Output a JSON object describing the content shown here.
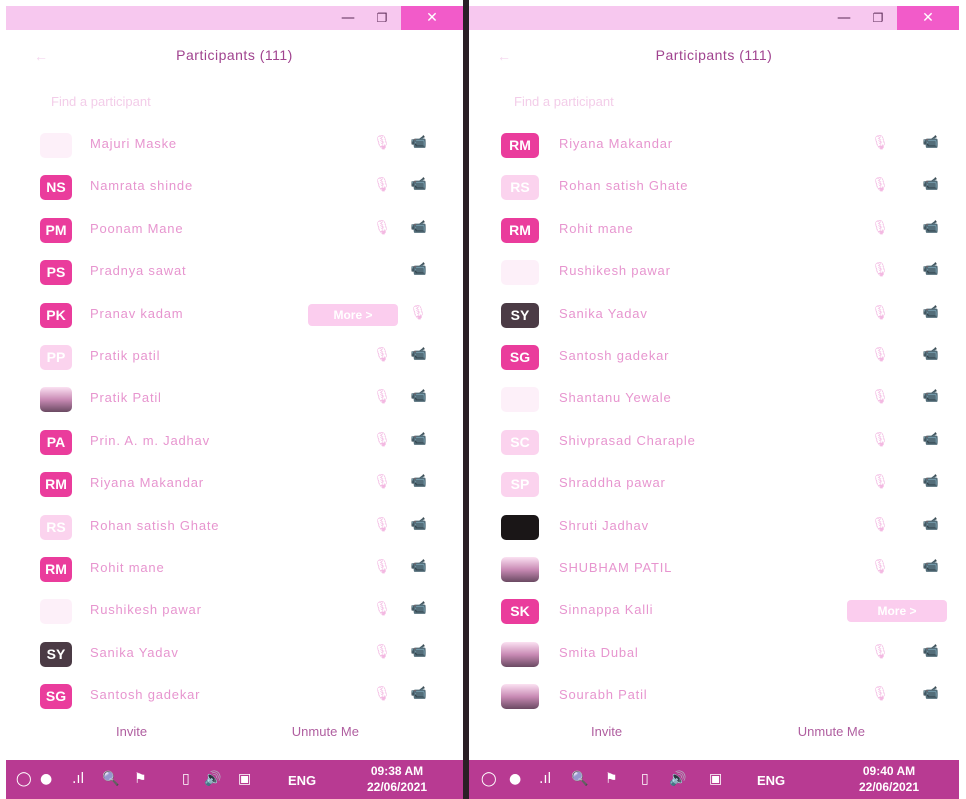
{
  "left": {
    "window": {
      "minimize": "—",
      "maximize": "❐",
      "close": "✕"
    },
    "header": {
      "back_icon": "←",
      "title": "Participants (111)"
    },
    "search": {
      "placeholder": "Find a participant"
    },
    "participants": [
      {
        "initials": "",
        "name": "Majuri Maske",
        "avatar": "blank",
        "icons": "mic-cam"
      },
      {
        "initials": "NS",
        "name": "Namrata shinde",
        "avatar": "solid",
        "icons": "mic-cam"
      },
      {
        "initials": "PM",
        "name": "Poonam Mane",
        "avatar": "solid",
        "icons": "mic-cam"
      },
      {
        "initials": "PS",
        "name": "Pradnya sawat",
        "avatar": "solid",
        "icons": "cam"
      },
      {
        "initials": "PK",
        "name": "Pranav kadam",
        "avatar": "solid",
        "icons": "more-mic",
        "more": "More >"
      },
      {
        "initials": "PP",
        "name": "Pratik patil",
        "avatar": "faded",
        "icons": "mic-cam"
      },
      {
        "initials": "",
        "name": "Pratik Patil",
        "avatar": "photo",
        "icons": "mic-cam"
      },
      {
        "initials": "PA",
        "name": "Prin. A. m. Jadhav",
        "avatar": "solid",
        "icons": "mic-cam"
      },
      {
        "initials": "RM",
        "name": "Riyana Makandar",
        "avatar": "solid",
        "icons": "mic-cam"
      },
      {
        "initials": "RS",
        "name": "Rohan satish Ghate",
        "avatar": "faded",
        "icons": "mic-cam"
      },
      {
        "initials": "RM",
        "name": "Rohit mane",
        "avatar": "solid",
        "icons": "mic-cam"
      },
      {
        "initials": "",
        "name": "Rushikesh pawar",
        "avatar": "blank",
        "icons": "mic-cam"
      },
      {
        "initials": "SY",
        "name": "Sanika Yadav",
        "avatar": "dark",
        "icons": "mic-cam"
      },
      {
        "initials": "SG",
        "name": "Santosh gadekar",
        "avatar": "solid",
        "icons": "mic-cam"
      }
    ],
    "footer": {
      "invite": "Invite",
      "unmute": "Unmute Me"
    },
    "taskbar": {
      "lang": "ENG",
      "time": "09:38 AM",
      "date": "22/06/2021"
    }
  },
  "right": {
    "window": {
      "minimize": "—",
      "maximize": "❐",
      "close": "✕"
    },
    "header": {
      "back_icon": "←",
      "title": "Participants (111)"
    },
    "search": {
      "placeholder": "Find a participant"
    },
    "participants": [
      {
        "initials": "RM",
        "name": "Riyana Makandar",
        "avatar": "solid",
        "icons": "mic-cam"
      },
      {
        "initials": "RS",
        "name": "Rohan satish Ghate",
        "avatar": "faded",
        "icons": "mic-cam"
      },
      {
        "initials": "RM",
        "name": "Rohit mane",
        "avatar": "solid",
        "icons": "mic-cam"
      },
      {
        "initials": "",
        "name": "Rushikesh pawar",
        "avatar": "blank",
        "icons": "mic-cam"
      },
      {
        "initials": "SY",
        "name": "Sanika Yadav",
        "avatar": "dark",
        "icons": "mic-cam"
      },
      {
        "initials": "SG",
        "name": "Santosh gadekar",
        "avatar": "solid",
        "icons": "mic-cam"
      },
      {
        "initials": "",
        "name": "Shantanu Yewale",
        "avatar": "blank",
        "icons": "mic-cam"
      },
      {
        "initials": "SC",
        "name": "Shivprasad Charaple",
        "avatar": "faded",
        "icons": "mic-cam"
      },
      {
        "initials": "SP",
        "name": "Shraddha pawar",
        "avatar": "faded",
        "icons": "mic-cam"
      },
      {
        "initials": "",
        "name": "Shruti Jadhav",
        "avatar": "black",
        "icons": "mic-cam"
      },
      {
        "initials": "",
        "name": "SHUBHAM PATIL",
        "avatar": "photo",
        "icons": "mic-cam"
      },
      {
        "initials": "SK",
        "name": "Sinnappa Kalli",
        "avatar": "solid",
        "icons": "more",
        "more": "More >"
      },
      {
        "initials": "",
        "name": "Smita Dubal",
        "avatar": "photo",
        "icons": "mic-cam"
      },
      {
        "initials": "",
        "name": "Sourabh Patil",
        "avatar": "photo",
        "icons": "mic-cam"
      }
    ],
    "footer": {
      "invite": "Invite",
      "unmute": "Unmute Me"
    },
    "taskbar": {
      "lang": "ENG",
      "time": "09:40 AM",
      "date": "22/06/2021"
    }
  },
  "icons": {
    "mic": "🎙",
    "cam": "📹",
    "start": "◯",
    "search": "🔍",
    "flag": "⚑",
    "battery": "▯",
    "volume": "🔊",
    "signal": ".ıl"
  }
}
